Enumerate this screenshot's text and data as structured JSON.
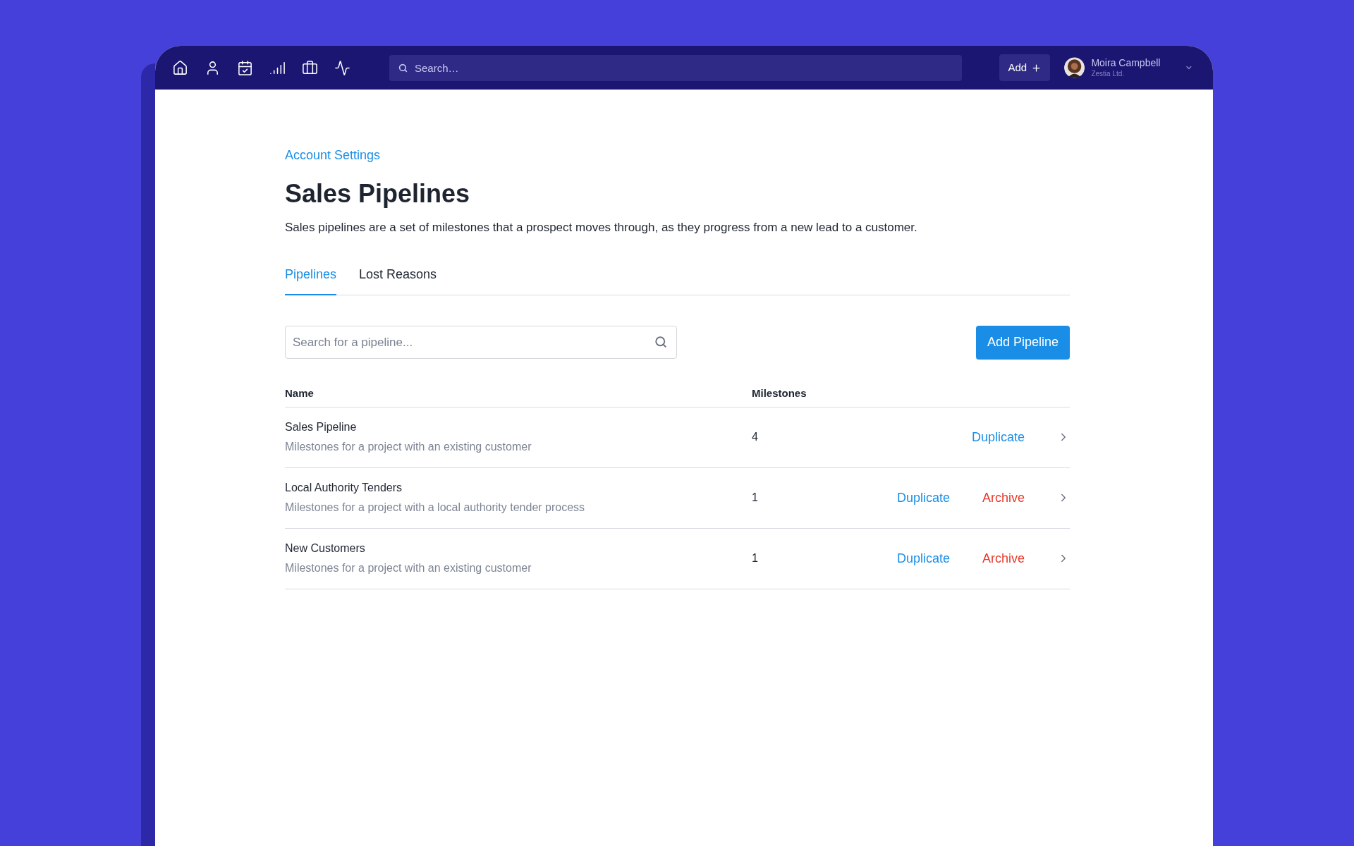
{
  "nav": {
    "search": {
      "placeholder": "Search…"
    },
    "add_button": "Add",
    "user": {
      "name": "Moira Campbell",
      "company": "Zestia Ltd."
    }
  },
  "breadcrumb": "Account Settings",
  "title": "Sales Pipelines",
  "description": "Sales pipelines are a set of milestones that a prospect moves through, as they progress from a new lead to a customer.",
  "tabs": [
    {
      "label": "Pipelines",
      "selected": true
    },
    {
      "label": "Lost Reasons",
      "selected": false
    }
  ],
  "pipeline_search": {
    "placeholder": "Search for a pipeline..."
  },
  "add_pipeline_button": "Add Pipeline",
  "table": {
    "columns": [
      "Name",
      "Milestones"
    ],
    "rows": [
      {
        "name": "Sales Pipeline",
        "description": "Milestones for a project with an existing customer",
        "milestones": "4",
        "actions": [
          "Duplicate"
        ]
      },
      {
        "name": "Local Authority Tenders",
        "description": "Milestones for a project with a local authority tender process",
        "milestones": "1",
        "actions": [
          "Duplicate",
          "Archive"
        ]
      },
      {
        "name": "New Customers",
        "description": "Milestones for a project with an existing customer",
        "milestones": "1",
        "actions": [
          "Duplicate",
          "Archive"
        ]
      }
    ]
  }
}
